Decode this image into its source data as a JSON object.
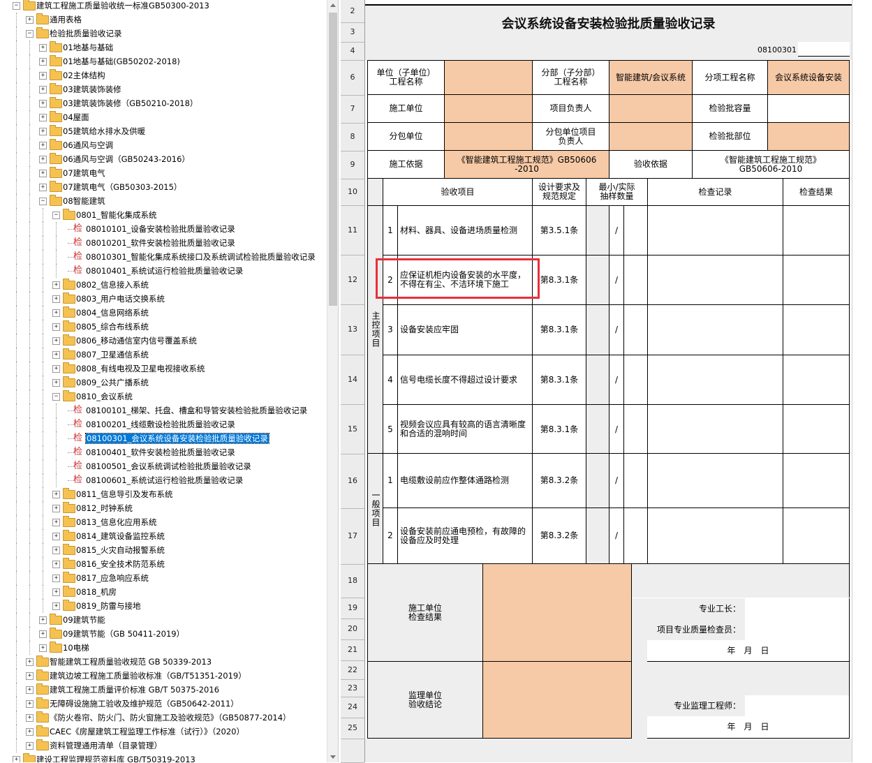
{
  "tree": {
    "nodes": [
      {
        "label": "建筑工程施工质量验收统一标准GB50300-2013",
        "type": "folder",
        "level": 0,
        "expanded": true
      },
      {
        "label": "通用表格",
        "type": "folder",
        "level": 1,
        "expanded": false
      },
      {
        "label": "检验批质量验收记录",
        "type": "folder",
        "level": 1,
        "expanded": true
      },
      {
        "label": "01地基与基础",
        "type": "folder",
        "level": 2,
        "expanded": false
      },
      {
        "label": "01地基与基础(GB50202-2018)",
        "type": "folder",
        "level": 2,
        "expanded": false
      },
      {
        "label": "02主体结构",
        "type": "folder",
        "level": 2,
        "expanded": false
      },
      {
        "label": "03建筑装饰装修",
        "type": "folder",
        "level": 2,
        "expanded": false
      },
      {
        "label": "03建筑装饰装修（GB50210-2018）",
        "type": "folder",
        "level": 2,
        "expanded": false
      },
      {
        "label": "04屋面",
        "type": "folder",
        "level": 2,
        "expanded": false
      },
      {
        "label": "05建筑给水排水及供暖",
        "type": "folder",
        "level": 2,
        "expanded": false
      },
      {
        "label": "06通风与空调",
        "type": "folder",
        "level": 2,
        "expanded": false
      },
      {
        "label": "06通风与空调（GB50243-2016）",
        "type": "folder",
        "level": 2,
        "expanded": false
      },
      {
        "label": "07建筑电气",
        "type": "folder",
        "level": 2,
        "expanded": false
      },
      {
        "label": "07建筑电气（GB50303-2015）",
        "type": "folder",
        "level": 2,
        "expanded": false
      },
      {
        "label": "08智能建筑",
        "type": "folder",
        "level": 2,
        "expanded": true
      },
      {
        "label": "0801_智能化集成系统",
        "type": "folder",
        "level": 3,
        "expanded": true
      },
      {
        "label": "08010101_设备安装检验批质量验收记录",
        "type": "doc",
        "level": 4
      },
      {
        "label": "08010201_软件安装检验批质量验收记录",
        "type": "doc",
        "level": 4
      },
      {
        "label": "08010301_智能化集成系统接口及系统调试检验批质量验收记录",
        "type": "doc",
        "level": 4
      },
      {
        "label": "08010401_系统试运行检验批质量验收记录",
        "type": "doc",
        "level": 4
      },
      {
        "label": "0802_信息接入系统",
        "type": "folder",
        "level": 3,
        "expanded": false
      },
      {
        "label": "0803_用户电话交换系统",
        "type": "folder",
        "level": 3,
        "expanded": false
      },
      {
        "label": "0804_信息网络系统",
        "type": "folder",
        "level": 3,
        "expanded": false
      },
      {
        "label": "0805_综合布线系统",
        "type": "folder",
        "level": 3,
        "expanded": false
      },
      {
        "label": "0806_移动通信室内信号覆盖系统",
        "type": "folder",
        "level": 3,
        "expanded": false
      },
      {
        "label": "0807_卫星通信系统",
        "type": "folder",
        "level": 3,
        "expanded": false
      },
      {
        "label": "0808_有线电视及卫星电视接收系统",
        "type": "folder",
        "level": 3,
        "expanded": false
      },
      {
        "label": "0809_公共广播系统",
        "type": "folder",
        "level": 3,
        "expanded": false
      },
      {
        "label": "0810_会议系统",
        "type": "folder",
        "level": 3,
        "expanded": true
      },
      {
        "label": "08100101_梯架、托盘、槽盒和导管安装检验批质量验收记录",
        "type": "doc",
        "level": 4
      },
      {
        "label": "08100201_线缆敷设检验批质量验收记录",
        "type": "doc",
        "level": 4
      },
      {
        "label": "08100301_会议系统设备安装检验批质量验收记录",
        "type": "doc",
        "level": 4,
        "selected": true
      },
      {
        "label": "08100401_软件安装检验批质量验收记录",
        "type": "doc",
        "level": 4
      },
      {
        "label": "08100501_会议系统调试检验批质量验收记录",
        "type": "doc",
        "level": 4
      },
      {
        "label": "08100601_系统试运行检验批质量验收记录",
        "type": "doc",
        "level": 4
      },
      {
        "label": "0811_信息导引及发布系统",
        "type": "folder",
        "level": 3,
        "expanded": false
      },
      {
        "label": "0812_时钟系统",
        "type": "folder",
        "level": 3,
        "expanded": false
      },
      {
        "label": "0813_信息化应用系统",
        "type": "folder",
        "level": 3,
        "expanded": false
      },
      {
        "label": "0814_建筑设备监控系统",
        "type": "folder",
        "level": 3,
        "expanded": false
      },
      {
        "label": "0815_火灾自动报警系统",
        "type": "folder",
        "level": 3,
        "expanded": false
      },
      {
        "label": "0816_安全技术防范系统",
        "type": "folder",
        "level": 3,
        "expanded": false
      },
      {
        "label": "0817_应急响应系统",
        "type": "folder",
        "level": 3,
        "expanded": false
      },
      {
        "label": "0818_机房",
        "type": "folder",
        "level": 3,
        "expanded": false
      },
      {
        "label": "0819_防雷与接地",
        "type": "folder",
        "level": 3,
        "expanded": false
      },
      {
        "label": "09建筑节能",
        "type": "folder",
        "level": 2,
        "expanded": false
      },
      {
        "label": "09建筑节能（GB 50411-2019）",
        "type": "folder",
        "level": 2,
        "expanded": false
      },
      {
        "label": "10电梯",
        "type": "folder",
        "level": 2,
        "expanded": false
      },
      {
        "label": "智能建筑工程质量验收规范 GB 50339-2013",
        "type": "folder",
        "level": 1,
        "expanded": false
      },
      {
        "label": "建筑边坡工程施工质量验收标准（GB/T51351-2019）",
        "type": "folder",
        "level": 1,
        "expanded": false
      },
      {
        "label": "建筑工程施工质量评价标准 GB/T 50375-2016",
        "type": "folder",
        "level": 1,
        "expanded": false
      },
      {
        "label": "无障碍设施施工验收及维护规范（GB50642-2011）",
        "type": "folder",
        "level": 1,
        "expanded": false
      },
      {
        "label": "《防火卷帘、防火门、防火窗施工及验收规范》（GB50877-2014）",
        "type": "folder",
        "level": 1,
        "expanded": false
      },
      {
        "label": "CAEC《房屋建筑工程监理工作标准（试行）》（2020）",
        "type": "folder",
        "level": 1,
        "expanded": false
      },
      {
        "label": "资料管理通用清单（目录管理）",
        "type": "folder",
        "level": 1,
        "expanded": false
      },
      {
        "label": "建设工程监理规范资料库 GB/T50319-2013",
        "type": "folder",
        "level": 0,
        "expanded": false
      }
    ],
    "doc_icon": "检"
  },
  "row_numbers": [
    "2",
    "3",
    "4",
    "6",
    "7",
    "8",
    "9",
    "10",
    "11",
    "12",
    "13",
    "14",
    "15",
    "16",
    "17",
    "18",
    "19",
    "20",
    "21",
    "22",
    "23",
    "24",
    "25"
  ],
  "form": {
    "title": "会议系统设备安装检验批质量验收记录",
    "code": "08100301",
    "unit_project_label": "单位（子单位）\n工程名称",
    "division_label": "分部（子分部）\n工程名称",
    "division_value": "智能建筑/会议系统",
    "subitem_label": "分项工程名称",
    "subitem_value": "会议系统设备安装",
    "contractor_label": "施工单位",
    "project_manager_label": "项目负责人",
    "batch_capacity_label": "检验批容量",
    "subcontractor_label": "分包单位",
    "sub_manager_label": "分包单位项目\n负责人",
    "batch_location_label": "检验批部位",
    "construction_basis_label": "施工依据",
    "construction_basis_value": "《智能建筑工程施工规范》GB50606\n-2010",
    "acceptance_basis_label": "验收依据",
    "acceptance_basis_value": "《智能建筑工程施工规范》\nGB50606-2010",
    "col_item": "验收项目",
    "col_design": "设计要求及\n规范规定",
    "col_sample": "最小/实际\n抽样数量",
    "col_record": "检查记录",
    "col_result": "检查结果",
    "main_group_label": "主控项目",
    "general_group_label": "一般项目",
    "main_items": [
      {
        "no": "1",
        "desc": "材料、器具、设备进场质量检测",
        "ref": "第3.5.1条",
        "slash": "/"
      },
      {
        "no": "2",
        "desc": "应保证机柜内设备安装的水平度，不得在有尘、不洁环境下施工",
        "ref": "第8.3.1条",
        "slash": "/"
      },
      {
        "no": "3",
        "desc": "设备安装应牢固",
        "ref": "第8.3.1条",
        "slash": "/"
      },
      {
        "no": "4",
        "desc": "信号电缆长度不得超过设计要求",
        "ref": "第8.3.1条",
        "slash": "/"
      },
      {
        "no": "5",
        "desc": "视频会议应具有较高的语言清晰度和合适的混响时间",
        "ref": "第8.3.1条",
        "slash": "/"
      }
    ],
    "general_items": [
      {
        "no": "1",
        "desc": "电缆敷设前应作整体通路检测",
        "ref": "第8.3.2条",
        "slash": "/"
      },
      {
        "no": "2",
        "desc": "设备安装前应通电预检，有故障的设备应及时处理",
        "ref": "第8.3.2条",
        "slash": "/"
      }
    ],
    "contractor_result_label": "施工单位\n检查结果",
    "foreman_label": "专业工长：",
    "qc_label": "项目专业质量检查员：",
    "date_label": "年　月　日",
    "supervisor_label": "监理单位\n验收结论",
    "engineer_label": "专业监理工程师：",
    "date_label2": "年　月　日"
  },
  "colors": {
    "peach": "#f7caa7",
    "highlight": "#e8303a",
    "selection": "#0078d7"
  }
}
